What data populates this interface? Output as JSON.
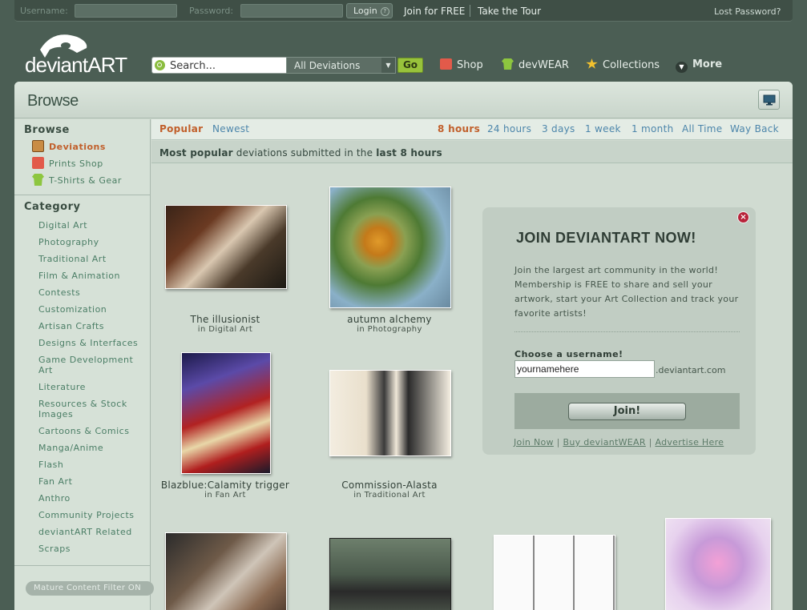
{
  "topbar": {
    "username_label": "Username:",
    "password_label": "Password:",
    "login_label": "Login",
    "login_help": "?",
    "join_link": "Join for FREE",
    "tour_link": "Take the Tour",
    "lost_password": "Lost Password?"
  },
  "logo": {
    "wordmark": "deviantART"
  },
  "search": {
    "placeholder": "Search...",
    "scope": "All Deviations",
    "go_label": "Go"
  },
  "nav": [
    {
      "label": "Shop",
      "icon": "shopping-bag-icon",
      "color": "#e25a4a"
    },
    {
      "label": "devWEAR",
      "icon": "tshirt-icon",
      "color": "#8dc63f"
    },
    {
      "label": "Collections",
      "icon": "star-icon",
      "color": "#f2c12e"
    },
    {
      "label": "More",
      "icon": "chevron-down-icon",
      "color": "#ffffff"
    }
  ],
  "browse": {
    "title": "Browse"
  },
  "sidebar": {
    "browse_heading": "Browse",
    "browse_items": [
      {
        "label": "Deviations",
        "icon": "deviations-icon",
        "active": true
      },
      {
        "label": "Prints Shop",
        "icon": "prints-icon",
        "active": false
      },
      {
        "label": "T-Shirts & Gear",
        "icon": "tshirt-icon",
        "active": false
      }
    ],
    "category_heading": "Category",
    "categories": [
      "Digital Art",
      "Photography",
      "Traditional Art",
      "Film & Animation",
      "Contests",
      "Customization",
      "Artisan Crafts",
      "Designs & Interfaces",
      "Game Development Art",
      "Literature",
      "Resources & Stock Images",
      "Cartoons & Comics",
      "Manga/Anime",
      "Flash",
      "Fan Art",
      "Anthro",
      "Community Projects",
      "deviantART Related",
      "Scraps"
    ],
    "mature_filter": "Mature Content Filter ON"
  },
  "sort_tabs": [
    {
      "label": "Popular",
      "active": true
    },
    {
      "label": "Newest",
      "active": false
    }
  ],
  "time_tabs": [
    {
      "label": "8 hours",
      "active": true
    },
    {
      "label": "24 hours",
      "active": false
    },
    {
      "label": "3 days",
      "active": false
    },
    {
      "label": "1 week",
      "active": false
    },
    {
      "label": "1 month",
      "active": false
    },
    {
      "label": "All Time",
      "active": false
    },
    {
      "label": "Way Back",
      "active": false
    }
  ],
  "subtitle": {
    "part1": "Most popular",
    "part2": " deviations submitted in the ",
    "part3": "last 8 hours"
  },
  "deviations": [
    {
      "title": "The illusionist",
      "category": "in Digital Art"
    },
    {
      "title": "autumn alchemy",
      "category": "in Photography"
    },
    {
      "title": "Blazblue:Calamity trigger",
      "category": "in Fan Art"
    },
    {
      "title": "Commission-Alasta",
      "category": "in Traditional Art"
    }
  ],
  "join_box": {
    "close": "×",
    "title": "JOIN DEVIANTART NOW!",
    "text": "Join the largest art community in the world! Membership is FREE to share and sell your artwork, start your Art Collection and track your favorite artists!",
    "label": "Choose a username!",
    "input_value": "yournamehere",
    "domain": ".deviantart.com",
    "button": "Join!",
    "links": [
      "Join Now",
      "Buy deviantWEAR",
      "Advertise Here"
    ],
    "link_sep": " | "
  }
}
